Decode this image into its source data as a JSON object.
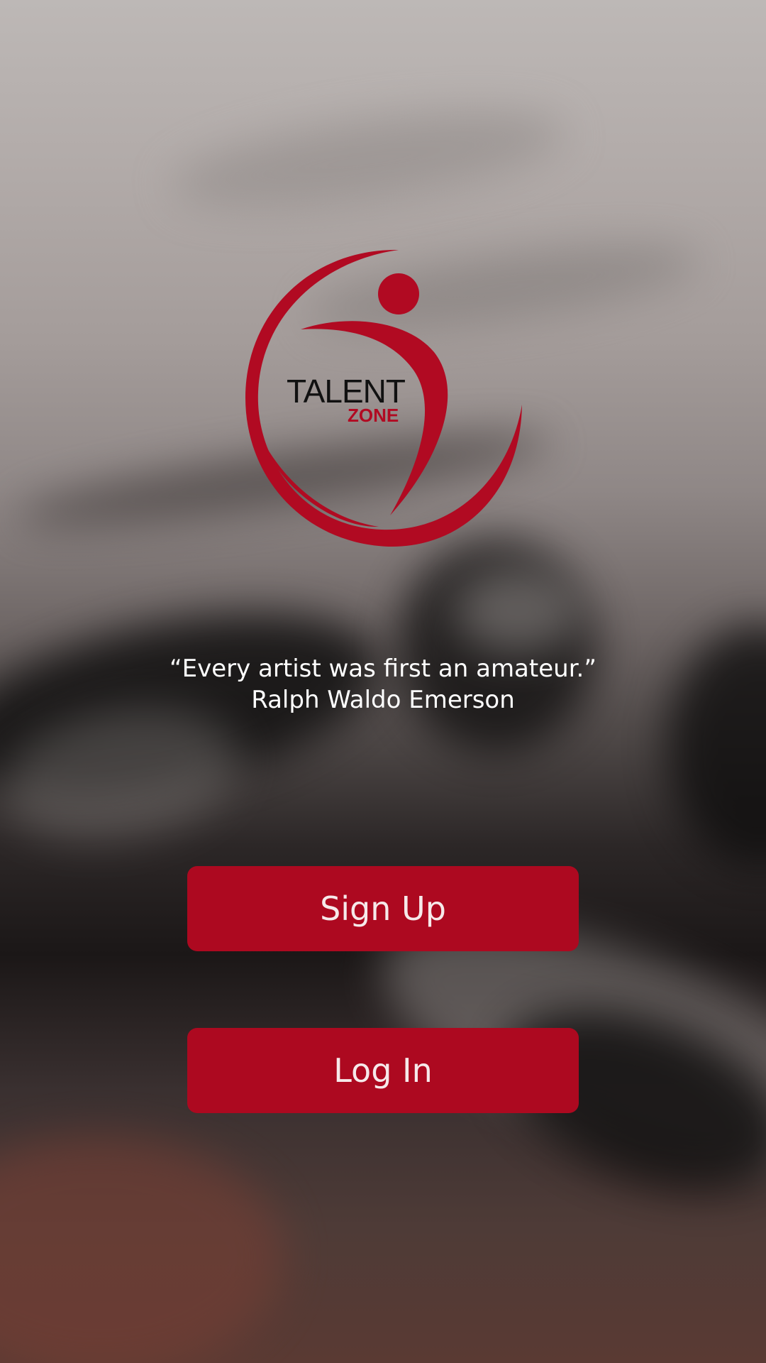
{
  "brand": {
    "name_line1": "TALENT",
    "name_line2": "ZONE",
    "accent_color": "#ad0920"
  },
  "quote": {
    "text": "“Every artist was first an amateur.”",
    "author": "Ralph Waldo Emerson"
  },
  "actions": {
    "signup_label": "Sign Up",
    "login_label": "Log In"
  }
}
